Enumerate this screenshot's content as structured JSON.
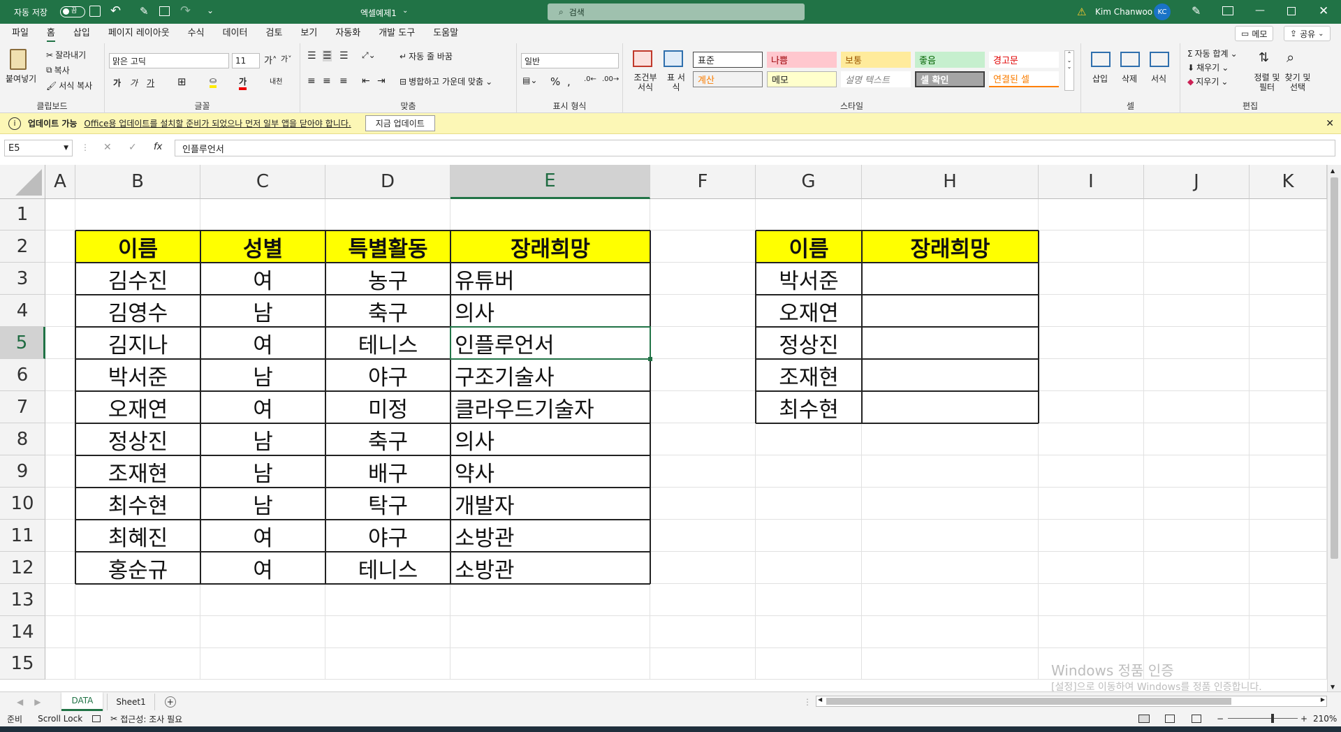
{
  "titlebar": {
    "autosave": "자동 저장",
    "autosave_state": "끔",
    "doc_title": "엑셀예제1",
    "search_placeholder": "검색",
    "user": "Kim Chanwoo",
    "initials": "KC"
  },
  "menus": [
    "파일",
    "홈",
    "삽입",
    "페이지 레이아웃",
    "수식",
    "데이터",
    "검토",
    "보기",
    "자동화",
    "개발 도구",
    "도움말"
  ],
  "menu_buttons": {
    "memo": "메모",
    "share": "공유"
  },
  "ribbon": {
    "clipboard": {
      "paste": "붙여넣기",
      "cut": "잘라내기",
      "copy": "복사",
      "format_painter": "서식 복사",
      "label": "클립보드"
    },
    "font": {
      "name": "맑은 고딕",
      "size": "11",
      "label": "글꼴"
    },
    "align": {
      "wrap": "자동 줄 바꿈",
      "merge": "병합하고 가운데 맞춤",
      "label": "맞춤"
    },
    "number": {
      "format": "일반",
      "label": "표시 형식"
    },
    "styles": {
      "cond": "조건부 서식",
      "table": "표 서식",
      "cells": [
        [
          "표준",
          "나쁨",
          "보통",
          "좋음",
          "경고문"
        ],
        [
          "계산",
          "메모",
          "설명 텍스트",
          "셀 확인",
          "연결된 셀"
        ]
      ],
      "label": "스타일"
    },
    "cells": {
      "insert": "삽입",
      "delete": "삭제",
      "format": "서식",
      "label": "셀"
    },
    "edit": {
      "autosum": "자동 합계",
      "fill": "채우기",
      "clear": "지우기",
      "sort": "정렬 및 필터",
      "find": "찾기 및 선택",
      "label": "편집"
    }
  },
  "infobar": {
    "title": "업데이트 가능",
    "message": "Office용 업데이트를 설치할 준비가 되었으나 먼저 일부 앱을 닫아야 합니다.",
    "button": "지금 업데이트"
  },
  "formula": {
    "namebox": "E5",
    "content": "인플루언서"
  },
  "columns": [
    "A",
    "B",
    "C",
    "D",
    "E",
    "F",
    "G",
    "H",
    "I",
    "J",
    "K"
  ],
  "rows": [
    "1",
    "2",
    "3",
    "4",
    "5",
    "6",
    "7",
    "8",
    "9",
    "10",
    "11",
    "12",
    "13",
    "14",
    "15"
  ],
  "table1": {
    "headers": [
      "이름",
      "성별",
      "특별활동",
      "장래희망"
    ],
    "rows": [
      [
        "김수진",
        "여",
        "농구",
        "유튜버"
      ],
      [
        "김영수",
        "남",
        "축구",
        "의사"
      ],
      [
        "김지나",
        "여",
        "테니스",
        "인플루언서"
      ],
      [
        "박서준",
        "남",
        "야구",
        "구조기술사"
      ],
      [
        "오재연",
        "여",
        "미정",
        "클라우드기술자"
      ],
      [
        "정상진",
        "남",
        "축구",
        "의사"
      ],
      [
        "조재현",
        "남",
        "배구",
        "약사"
      ],
      [
        "최수현",
        "남",
        "탁구",
        "개발자"
      ],
      [
        "최혜진",
        "여",
        "야구",
        "소방관"
      ],
      [
        "홍순규",
        "여",
        "테니스",
        "소방관"
      ]
    ]
  },
  "table2": {
    "headers": [
      "이름",
      "장래희망"
    ],
    "rows": [
      "박서준",
      "오재연",
      "정상진",
      "조재현",
      "최수현"
    ]
  },
  "sheets": [
    "DATA",
    "Sheet1"
  ],
  "status": {
    "ready": "준비",
    "scroll": "Scroll Lock",
    "access": "접근성: 조사 필요",
    "zoom": "210%"
  },
  "watermark": {
    "line1": "Windows 정품 인증",
    "line2": "[설정]으로 이동하여 Windows를 정품 인증합니다."
  }
}
